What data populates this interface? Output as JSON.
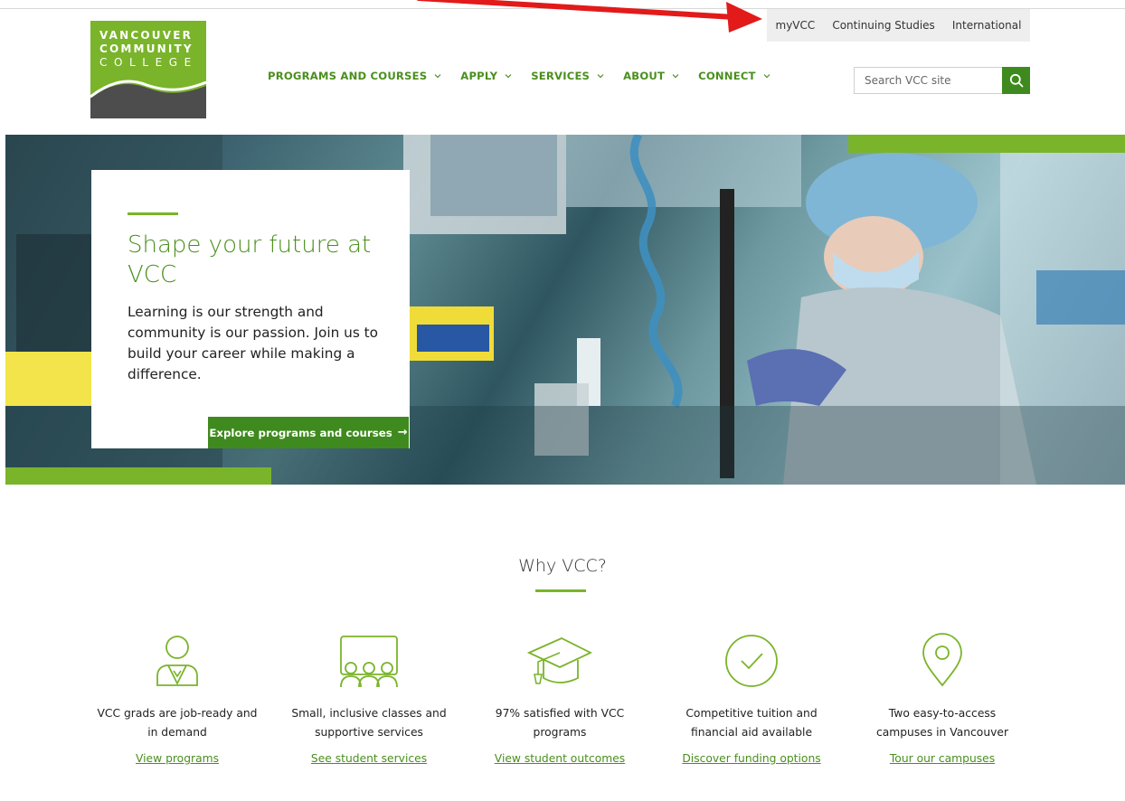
{
  "utility_nav": [
    "myVCC",
    "Continuing Studies",
    "International"
  ],
  "logo": {
    "line1": "VANCOUVER",
    "line2": "COMMUNITY",
    "line3": "COLLEGE"
  },
  "main_nav": [
    {
      "label": "PROGRAMS AND COURSES"
    },
    {
      "label": "APPLY"
    },
    {
      "label": "SERVICES"
    },
    {
      "label": "ABOUT"
    },
    {
      "label": "CONNECT"
    }
  ],
  "search": {
    "placeholder": "Search VCC site"
  },
  "hero": {
    "title": "Shape your future at VCC",
    "body": "Learning is our strength and community is our passion. Join us to build your career while making a difference.",
    "cta": "Explore programs and courses"
  },
  "why": {
    "title": "Why VCC?",
    "items": [
      {
        "icon": "person-icon",
        "text": "VCC grads are job-ready and in demand",
        "link": "View programs"
      },
      {
        "icon": "group-icon",
        "text": "Small, inclusive classes and supportive services",
        "link": "See student services"
      },
      {
        "icon": "graduation-cap-icon",
        "text": "97% satisfied with VCC programs",
        "link": "View student outcomes"
      },
      {
        "icon": "checkmark-circle-icon",
        "text": "Competitive tuition and financial aid available",
        "link": "Discover funding options"
      },
      {
        "icon": "location-pin-icon",
        "text": "Two easy-to-access campuses in Vancouver",
        "link": "Tour our campuses"
      }
    ]
  },
  "colors": {
    "brand_green": "#7ab42a",
    "dark_green": "#3f8a1e",
    "nav_green": "#4a8f1d",
    "annotation_red": "#e21a1a"
  }
}
